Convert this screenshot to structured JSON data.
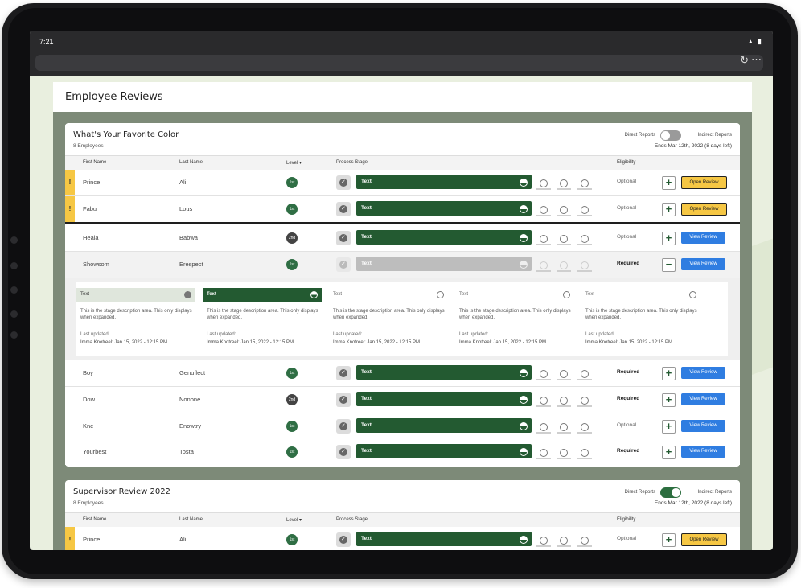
{
  "status": {
    "time": "7:21"
  },
  "app": {
    "title": "Employee Reviews"
  },
  "colors": {
    "brand_green": "#235a31",
    "accent_yellow": "#f6c744",
    "view_blue": "#2f7de1"
  },
  "headers": {
    "first_name": "First Name",
    "last_name": "Last Name",
    "level": "Level ▾",
    "process_stage": "Process Stage",
    "eligibility": "Eligibility"
  },
  "cards": [
    {
      "title": "What's Your Favorite Color",
      "subtitle": "8 Employees",
      "toggle_left": "Direct Reports",
      "toggle_right": "Indirect Reports",
      "toggle_on": false,
      "ends": "Ends Mar 12th, 2022 (8 days left)",
      "rows": [
        {
          "flag": "!",
          "first": "Prince",
          "last": "Ali",
          "level": "1st",
          "stage": "Text",
          "eligibility": "Optional",
          "action": "+",
          "button": "Open Review"
        },
        {
          "flag": "!",
          "first": "Fabu",
          "last": "Lous",
          "level": "1st",
          "stage": "Text",
          "eligibility": "Optional",
          "action": "+",
          "button": "Open Review"
        },
        {
          "first": "Heala",
          "last": "Babwa",
          "level": "2nd",
          "stage": "Text",
          "eligibility": "Optional",
          "action": "+",
          "button": "View Review"
        },
        {
          "first": "Showsom",
          "last": "Erespect",
          "level": "1st",
          "stage": "Text",
          "eligibility": "Required",
          "action": "−",
          "button": "View Review"
        },
        {
          "first": "Boy",
          "last": "Genuflect",
          "level": "1st",
          "stage": "Text",
          "eligibility": "Required",
          "action": "+",
          "button": "View Review"
        },
        {
          "first": "Dow",
          "last": "Nonone",
          "level": "2nd",
          "stage": "Text",
          "eligibility": "Required",
          "action": "+",
          "button": "View Review"
        },
        {
          "first": "Kne",
          "last": "Enowtry",
          "level": "1st",
          "stage": "Text",
          "eligibility": "Optional",
          "action": "+",
          "button": "View Review"
        },
        {
          "first": "Yourbest",
          "last": "Tosta",
          "level": "1st",
          "stage": "Text",
          "eligibility": "Required",
          "action": "+",
          "button": "View Review"
        }
      ],
      "expanded_stages": [
        {
          "label": "Text",
          "state": "complete",
          "description": "This is the stage description area. This only displays when expanded.",
          "updated_label": "Last updated:",
          "updated_by": "Imma Knotreel: Jan 15, 2022 - 12:15 PM"
        },
        {
          "label": "Text",
          "state": "current",
          "description": "This is the stage description area. This only displays when expanded.",
          "updated_label": "Last updated:",
          "updated_by": "Imma Knotreel: Jan 15, 2022 - 12:15 PM"
        },
        {
          "label": "Text",
          "state": "pending",
          "description": "This is the stage description area. This only displays when expanded.",
          "updated_label": "Last updated:",
          "updated_by": "Imma Knotreel: Jan 15, 2022 - 12:15 PM"
        },
        {
          "label": "Text",
          "state": "pending",
          "description": "This is the stage description area. This only displays when expanded.",
          "updated_label": "Last updated:",
          "updated_by": "Imma Knotreel: Jan 15, 2022 - 12:15 PM"
        },
        {
          "label": "Text",
          "state": "pending",
          "description": "This is the stage description area. This only displays when expanded.",
          "updated_label": "Last updated:",
          "updated_by": "Imma Knotreel: Jan 15, 2022 - 12:15 PM"
        }
      ]
    },
    {
      "title": "Supervisor Review 2022",
      "subtitle": "8 Employees",
      "toggle_left": "Direct Reports",
      "toggle_right": "Indirect Reports",
      "toggle_on": true,
      "ends": "Ends Mar 12th, 2022 (8 days left)",
      "rows": [
        {
          "flag": "!",
          "first": "Prince",
          "last": "Ali",
          "level": "1st",
          "stage": "Text",
          "eligibility": "Optional",
          "action": "+",
          "button": "Open Review"
        }
      ]
    }
  ]
}
